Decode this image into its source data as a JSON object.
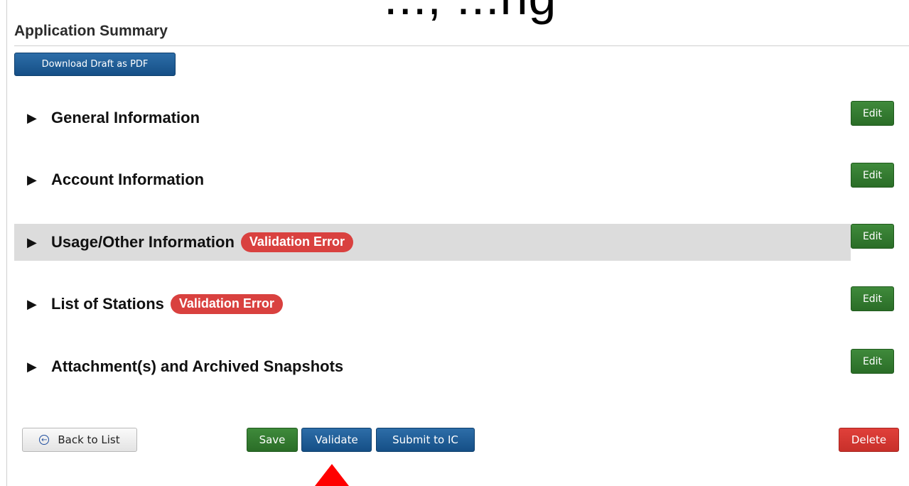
{
  "header": {
    "cut_off_text": "..., ...ng",
    "title": "Application Summary",
    "download_label": "Download Draft as PDF"
  },
  "sections": [
    {
      "label": "General Information",
      "badge": "",
      "edit_label": "Edit"
    },
    {
      "label": "Account Information",
      "badge": "",
      "edit_label": "Edit"
    },
    {
      "label": "Usage/Other Information",
      "badge": "Validation Error",
      "edit_label": "Edit"
    },
    {
      "label": "List of Stations",
      "badge": "Validation Error",
      "edit_label": "Edit"
    },
    {
      "label": "Attachment(s) and Archived Snapshots",
      "badge": "",
      "edit_label": "Edit"
    }
  ],
  "footer": {
    "back_label": "Back to List",
    "save_label": "Save",
    "validate_label": "Validate",
    "submit_label": "Submit to IC",
    "delete_label": "Delete"
  },
  "icons": {
    "expand": "triangle-right-icon",
    "back": "circle-arrow-left-icon",
    "pointer": "red-up-arrow-annotation"
  },
  "colors": {
    "primary_blue": "#1b5a96",
    "success_green": "#347e30",
    "danger_red": "#d9413f",
    "highlight_row": "#dcdcdc"
  }
}
